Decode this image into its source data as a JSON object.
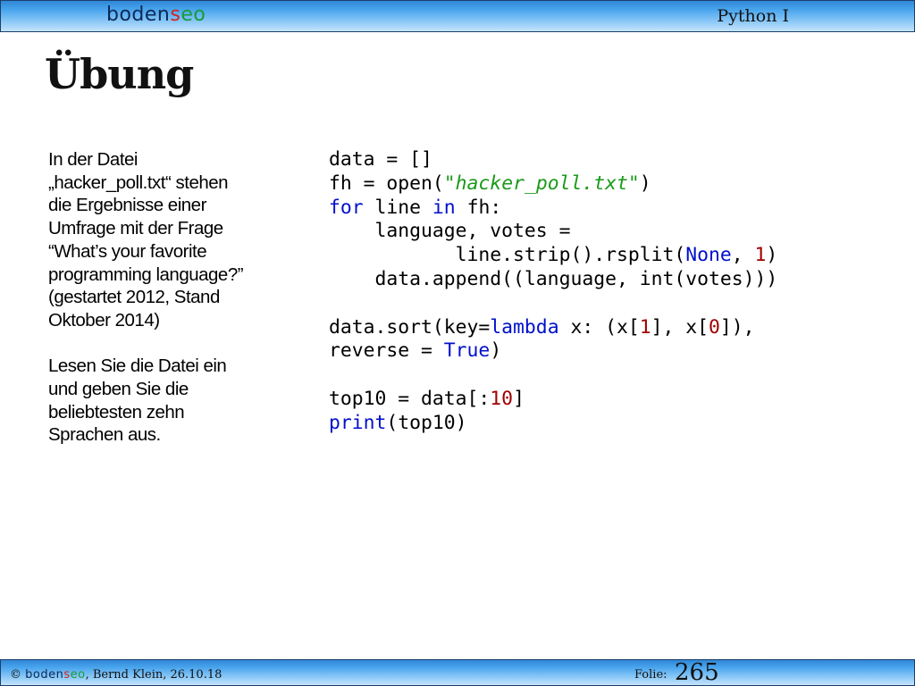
{
  "header": {
    "logo": {
      "part1": "boden",
      "part2": "s",
      "part3": "eo"
    },
    "course": "Python I"
  },
  "slide": {
    "title": "Übung",
    "task": [
      "In der Datei\n„hacker_poll.txt“ stehen\ndie Ergebnisse einer\nUmfrage mit der Frage\n“What’s your favorite\nprogramming language?”\n(gestartet 2012, Stand\nOktober 2014)",
      "Lesen Sie die Datei ein\nund geben Sie die\nbeliebtesten zehn\nSprachen aus."
    ],
    "code": [
      [
        [
          "data = []",
          "t"
        ]
      ],
      [
        [
          "fh = open(",
          "t"
        ],
        [
          "\"hacker_poll.txt\"",
          "str"
        ],
        [
          ")",
          "t"
        ]
      ],
      [
        [
          "for",
          "kw"
        ],
        [
          " line ",
          "t"
        ],
        [
          "in",
          "kw"
        ],
        [
          " fh:",
          "t"
        ]
      ],
      [
        [
          "    language, votes =",
          "t"
        ]
      ],
      [
        [
          "           line.strip().rsplit(",
          "t"
        ],
        [
          "None",
          "kw"
        ],
        [
          ", ",
          "t"
        ],
        [
          "1",
          "num"
        ],
        [
          ")",
          "t"
        ]
      ],
      [
        [
          "    data.append((language, int(votes)))",
          "t"
        ]
      ],
      [],
      [
        [
          "data.sort(key=",
          "t"
        ],
        [
          "lambda",
          "kw"
        ],
        [
          " x: (x[",
          "t"
        ],
        [
          "1",
          "num"
        ],
        [
          "], x[",
          "t"
        ],
        [
          "0",
          "num"
        ],
        [
          "]),",
          "t"
        ]
      ],
      [
        [
          "reverse = ",
          "t"
        ],
        [
          "True",
          "kw"
        ],
        [
          ")",
          "t"
        ]
      ],
      [],
      [
        [
          "top10 = data[:",
          "t"
        ],
        [
          "10",
          "num"
        ],
        [
          "]",
          "t"
        ]
      ],
      [
        [
          "print",
          "kw"
        ],
        [
          "(top10)",
          "t"
        ]
      ]
    ]
  },
  "footer": {
    "copyright_symbol": "©",
    "logo": {
      "part1": "boden",
      "part2": "s",
      "part3": "eo"
    },
    "author_date": ", Bernd Klein, 26.10.18",
    "folio_label": "Folie:",
    "page_number": "265"
  },
  "colors": {
    "keyword": "#0010cc",
    "string": "#1a9a1a",
    "number": "#a00000",
    "logo_dark": "#0b2a57",
    "logo_red": "#d0261d",
    "logo_green": "#199a3a"
  }
}
